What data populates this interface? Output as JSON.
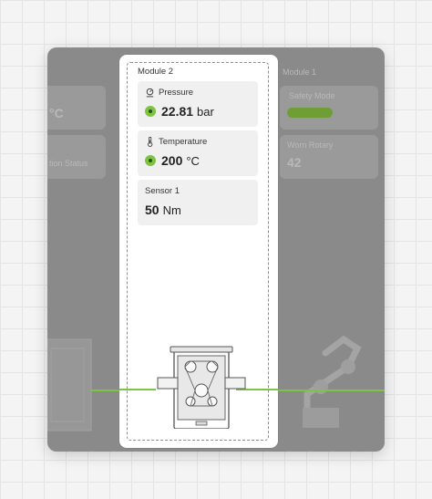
{
  "module": {
    "title": "Module 2",
    "cards": [
      {
        "label": "Pressure",
        "icon": "pressure-gauge-icon",
        "value": "22.81",
        "unit": "bar",
        "status": "ok"
      },
      {
        "label": "Temperature",
        "icon": "thermometer-icon",
        "value": "200",
        "unit": "°C",
        "status": "ok"
      },
      {
        "label": "Sensor 1",
        "value": "50",
        "unit": "Nm"
      }
    ]
  },
  "background": {
    "left_module": {
      "pressure_value": "°C",
      "status_label": "tion Status"
    },
    "right_module": {
      "title": "Module 1",
      "mode_label": "Safety Mode",
      "rotation_label": "Worn Rotary",
      "rotation_value": "42"
    }
  },
  "colors": {
    "accent": "#7cc442",
    "overlay": "#8a8a8a",
    "card": "#f0f0f0"
  }
}
